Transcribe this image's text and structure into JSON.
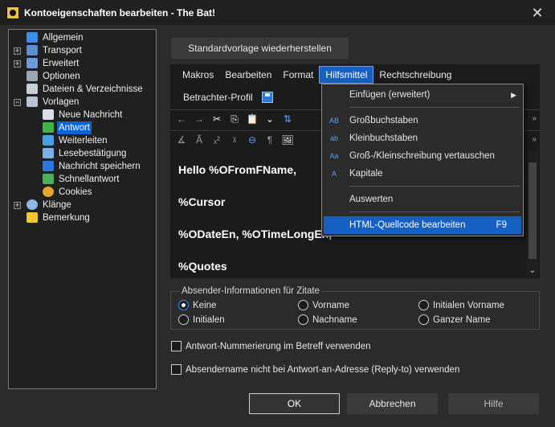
{
  "window": {
    "title": "Kontoeigenschaften bearbeiten - The Bat!",
    "close_glyph": "✕"
  },
  "tree": {
    "items": [
      {
        "label": "Allgemein",
        "icon": "globe-icon",
        "expander": ""
      },
      {
        "label": "Transport",
        "icon": "transport-icon",
        "expander": "+"
      },
      {
        "label": "Erweitert",
        "icon": "advanced-icon",
        "expander": "+"
      },
      {
        "label": "Optionen",
        "icon": "options-icon",
        "expander": ""
      },
      {
        "label": "Dateien & Verzeichnisse",
        "icon": "folder-files-icon",
        "expander": ""
      },
      {
        "label": "Vorlagen",
        "icon": "templates-icon",
        "expander": "−"
      },
      {
        "label": "Neue Nachricht",
        "icon": "new-message-icon",
        "expander": ""
      },
      {
        "label": "Antwort",
        "icon": "reply-icon",
        "expander": "",
        "selected": true
      },
      {
        "label": "Weiterleiten",
        "icon": "forward-icon",
        "expander": ""
      },
      {
        "label": "Lesebestätigung",
        "icon": "read-receipt-icon",
        "expander": ""
      },
      {
        "label": "Nachricht speichern",
        "icon": "save-message-icon",
        "expander": ""
      },
      {
        "label": "Schnellantwort",
        "icon": "quick-reply-icon",
        "expander": ""
      },
      {
        "label": "Cookies",
        "icon": "cookies-icon",
        "expander": ""
      },
      {
        "label": "Klänge",
        "icon": "sounds-icon",
        "expander": "+"
      },
      {
        "label": "Bemerkung",
        "icon": "note-icon",
        "expander": ""
      }
    ]
  },
  "reset_button": "Standardvorlage wiederherstellen",
  "menubar": {
    "items": [
      "Makros",
      "Bearbeiten",
      "Format",
      "Hilfsmittel",
      "Rechtschreibung"
    ],
    "active": "Hilfsmittel",
    "viewer_profile": "Betrachter-Profil"
  },
  "toolbar": {
    "row1": [
      "←",
      "→",
      "✂",
      "⎘",
      "📋",
      "⌄",
      "⇅"
    ],
    "row2": [
      "∡",
      "Ã",
      "ₓ²",
      "ᵡ",
      "⊖",
      "¶",
      "🖼"
    ],
    "more_glyph": "»"
  },
  "editor": {
    "lines": [
      "Hello %OFromFName,",
      "%Cursor",
      "%ODateEn, %OTimeLongEn,",
      "%Quotes"
    ],
    "scroll_down_glyph": "⌄"
  },
  "dropdown": {
    "items": {
      "insert_extended": "Einfügen (erweitert)",
      "uppercase": "Großbuchstaben",
      "lowercase": "Kleinbuchstaben",
      "swap_case": "Groß-/Kleinschreibung vertauschen",
      "capitals": "Kapitale",
      "evaluate": "Auswerten",
      "edit_html": "HTML-Quellcode bearbeiten"
    },
    "shortcut_edit_html": "F9",
    "submenu_arrow": "▶",
    "icon_glyphs": {
      "uppercase": "AB",
      "lowercase": "ab",
      "swap_case": "Aa",
      "capitals": "A"
    }
  },
  "sender_info": {
    "title": "Absender-Informationen für Zitate",
    "options": [
      {
        "label": "Keine",
        "checked": true
      },
      {
        "label": "Vorname",
        "checked": false
      },
      {
        "label": "Initialen Vorname",
        "checked": false
      },
      {
        "label": "Initialen",
        "checked": false
      },
      {
        "label": "Nachname",
        "checked": false
      },
      {
        "label": "Ganzer Name",
        "checked": false
      }
    ]
  },
  "checkboxes": {
    "numbering": {
      "label": "Antwort-Nummerierung im Betreff verwenden",
      "checked": false
    },
    "sendername": {
      "label": "Absendername nicht bei Antwort-an-Adresse (Reply-to) verwenden",
      "checked": false
    }
  },
  "buttons": {
    "ok": "OK",
    "cancel": "Abbrechen",
    "help": "Hilfe"
  },
  "colors": {
    "accent": "#1560c0",
    "background": "#2b2b2b",
    "panel": "#1b1b1b"
  }
}
